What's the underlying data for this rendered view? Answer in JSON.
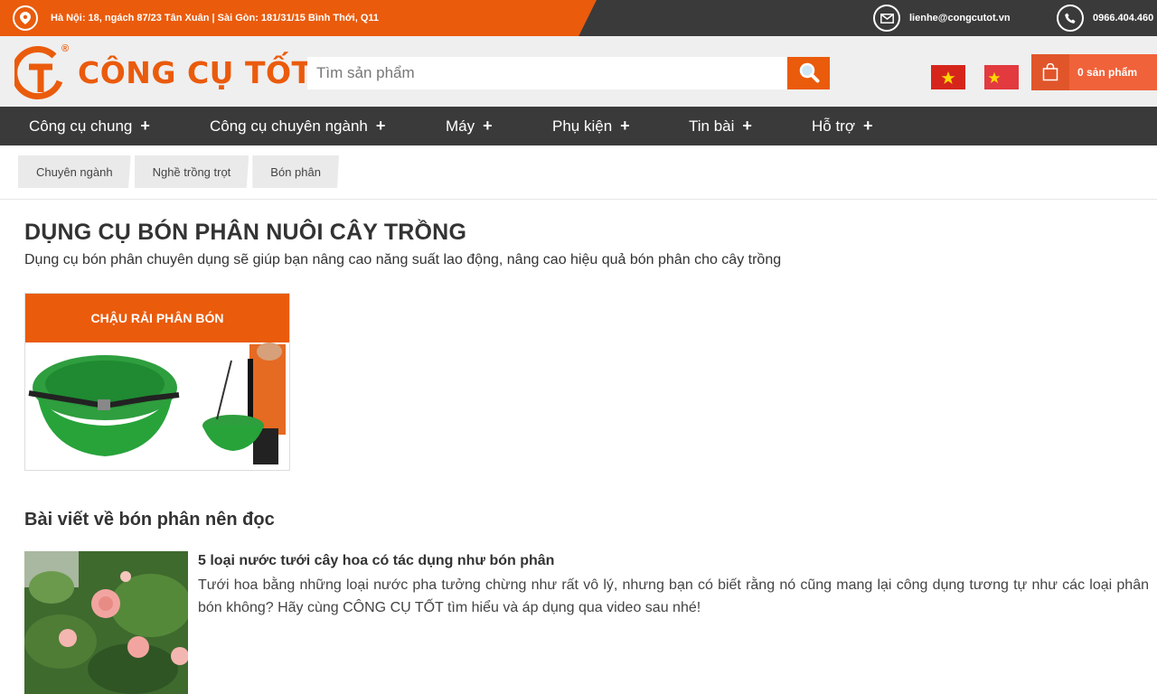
{
  "topbar": {
    "address": "Hà Nội: 18, ngách 87/23 Tân Xuân | Sài Gòn: 181/31/15 Bình Thới, Q11",
    "email": "lienhe@congcutot.vn",
    "phone": "0966.404.460",
    "icons": [
      "map-pin-icon",
      "envelope-icon",
      "phone-icon"
    ]
  },
  "header": {
    "logo_text": "CÔNG CỤ TỐT",
    "logo_mark_letters": "CT",
    "logo_registered": "®",
    "search_placeholder": "Tìm sản phẩm",
    "cart_label": "0 sản phẩm",
    "flags": [
      "vietnam-flag",
      "china-flag"
    ]
  },
  "nav": {
    "items": [
      {
        "label": "Công cụ chung",
        "plus": "+"
      },
      {
        "label": "Công cụ chuyên ngành",
        "plus": "+"
      },
      {
        "label": "Máy",
        "plus": "+"
      },
      {
        "label": "Phụ kiện",
        "plus": "+"
      },
      {
        "label": "Tin bài",
        "plus": "+"
      },
      {
        "label": "Hỗ trợ",
        "plus": "+"
      }
    ]
  },
  "breadcrumb": [
    "Chuyên ngành",
    "Nghề trồng trọt",
    "Bón phân"
  ],
  "main": {
    "title": "DỤNG CỤ BÓN PHÂN NUÔI CÂY TRỒNG",
    "description": "Dụng cụ bón phân chuyên dụng sẽ giúp bạn nâng cao năng suất lao động, nâng cao hiệu quả bón phân cho cây trồng",
    "category_card": {
      "title": "CHẬU RẢI PHÂN BÓN"
    },
    "section_title": "Bài viết về bón phân nên đọc",
    "article": {
      "title": "5 loại nước tưới cây hoa có tác dụng như bón phân",
      "excerpt": "Tưới hoa bằng những loại nước pha tưởng chừng như rất vô lý, nhưng bạn có biết rằng nó cũng mang lại công dụng tương tự như các loại phân bón không? Hãy cùng CÔNG CỤ TỐT tìm hiểu và áp dụng qua video sau nhé!"
    }
  },
  "colors": {
    "brand_orange": "#ea5b0c",
    "dark_bar": "#3a3a3a",
    "header_bg": "#efefef"
  }
}
